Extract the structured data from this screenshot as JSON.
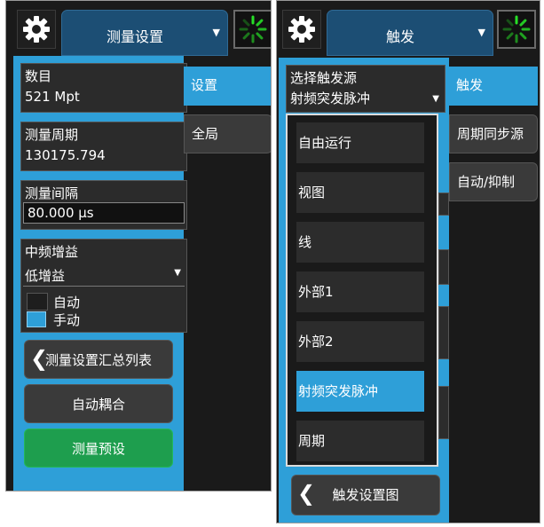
{
  "left": {
    "title": "测量设置",
    "fields": {
      "count_label": "数目",
      "count_value": "521 Mpt",
      "period_label": "测量周期",
      "period_value": "130175.794",
      "interval_label": "测量间隔",
      "interval_value": "80.000 µs",
      "gain_label": "中频增益",
      "gain_value": "低增益"
    },
    "mode": {
      "auto": "自动",
      "manual": "手动"
    },
    "buttons": {
      "summary": "测量设置汇总列表",
      "coupling": "自动耦合",
      "preset": "测量预设"
    },
    "tabs": {
      "settings": "设置",
      "global": "全局"
    }
  },
  "right": {
    "title": "触发",
    "select_label": "选择触发源",
    "select_value": "射频突发脉冲",
    "options": [
      "自由运行",
      "视图",
      "线",
      "外部1",
      "外部2",
      "射频突发脉冲",
      "周期"
    ],
    "selected_index": 5,
    "tabs": {
      "trigger": "触发",
      "sync": "周期同步源",
      "auto_holdoff": "自动/抑制"
    },
    "bottom_button": "触发设置图"
  },
  "icons": {
    "gear": "gear-icon",
    "spinner": "spinner-icon",
    "dropdown": "dropdown-arrow-icon",
    "back": "chevron-left-icon"
  },
  "colors": {
    "accent": "#2e9fd8",
    "green": "#1e9e4e",
    "header": "#1c4e74",
    "spinner": "#27e027"
  }
}
